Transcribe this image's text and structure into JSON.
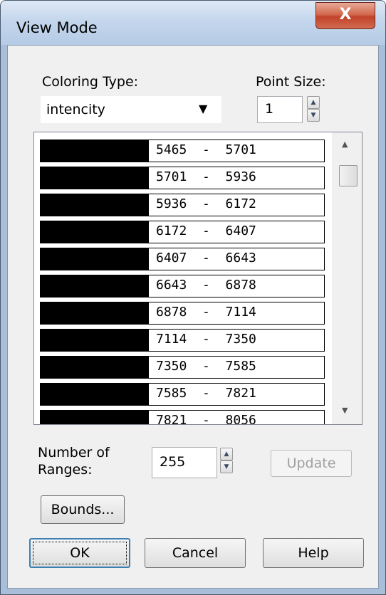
{
  "window": {
    "title": "View Mode",
    "close_glyph": "X"
  },
  "coloring_type": {
    "label": "Coloring Type:",
    "value": "intencity"
  },
  "point_size": {
    "label": "Point Size:",
    "value": "1"
  },
  "ranges": [
    "5465  -  5701",
    "5701  -  5936",
    "5936  -  6172",
    "6172  -  6407",
    "6407  -  6643",
    "6643  -  6878",
    "6878  -  7114",
    "7114  -  7350",
    "7350  -  7585",
    "7585  -  7821",
    "7821  -  8056"
  ],
  "swatch_color": "#000000",
  "number_of_ranges": {
    "label_line1": "Number of",
    "label_line2": "Ranges:",
    "value": "255"
  },
  "buttons": {
    "update": "Update",
    "bounds": "Bounds...",
    "ok": "OK",
    "cancel": "Cancel",
    "help": "Help"
  },
  "icons": {
    "dropdown": "chevron-down-icon",
    "spin_up": "arrow-up-icon",
    "spin_down": "arrow-down-icon",
    "scroll_up": "scroll-up-icon",
    "scroll_down": "scroll-down-icon",
    "close": "close-icon"
  }
}
